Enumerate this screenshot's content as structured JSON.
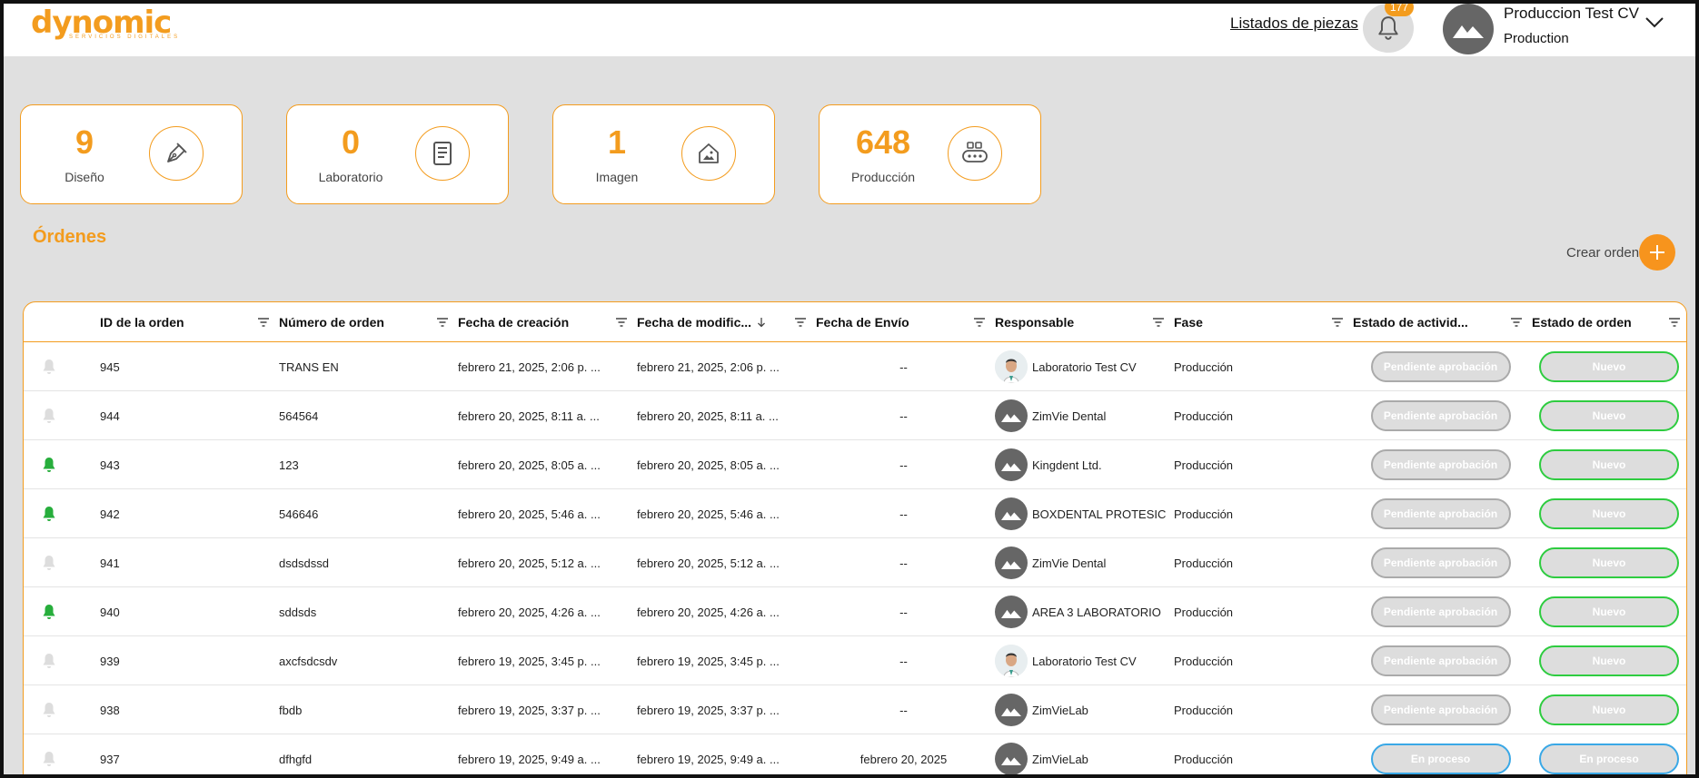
{
  "header": {
    "logo_text": "dynomic",
    "logo_sub": "SERVICIOS DIGITALES",
    "pieces_link": "Listados de piezas",
    "notifications_count": "177",
    "user_name": "Produccion Test CV",
    "user_role": "Production"
  },
  "cards": [
    {
      "value": "9",
      "label": "Diseño",
      "icon": "pen-nib-icon"
    },
    {
      "value": "0",
      "label": "Laboratorio",
      "icon": "document-icon"
    },
    {
      "value": "1",
      "label": "Imagen",
      "icon": "home-image-icon"
    },
    {
      "value": "648",
      "label": "Producción",
      "icon": "production-machine-icon"
    }
  ],
  "orders": {
    "title": "Órdenes",
    "create_label": "Crear orden"
  },
  "table": {
    "columns": [
      "ID de la orden",
      "Número de orden",
      "Fecha de creación",
      "Fecha de modific...",
      "Fecha de Envío",
      "Responsable",
      "Fase",
      "Estado de activid...",
      "Estado de orden"
    ],
    "rows": [
      {
        "alert": "off",
        "id": "945",
        "number": "TRANS EN",
        "created": "febrero 21, 2025, 2:06 p. ...",
        "modified": "febrero 21, 2025, 2:06 p. ...",
        "shipped": "--",
        "resp": "Laboratorio Test CV",
        "avatar": "photo",
        "phase": "Producción",
        "activity": "Pendiente aprobación",
        "activity_style": "gray",
        "status": "Nuevo",
        "status_style": "green"
      },
      {
        "alert": "off",
        "id": "944",
        "number": "564564",
        "created": "febrero 20, 2025, 8:11 a. ...",
        "modified": "febrero 20, 2025, 8:11 a. ...",
        "shipped": "--",
        "resp": "ZimVie Dental",
        "avatar": "generic",
        "phase": "Producción",
        "activity": "Pendiente aprobación",
        "activity_style": "gray",
        "status": "Nuevo",
        "status_style": "green"
      },
      {
        "alert": "on",
        "id": "943",
        "number": "123",
        "created": "febrero 20, 2025, 8:05 a. ...",
        "modified": "febrero 20, 2025, 8:05 a. ...",
        "shipped": "--",
        "resp": "Kingdent Ltd.",
        "avatar": "generic",
        "phase": "Producción",
        "activity": "Pendiente aprobación",
        "activity_style": "gray",
        "status": "Nuevo",
        "status_style": "green"
      },
      {
        "alert": "on",
        "id": "942",
        "number": "546646",
        "created": "febrero 20, 2025, 5:46 a. ...",
        "modified": "febrero 20, 2025, 5:46 a. ...",
        "shipped": "--",
        "resp": "BOXDENTAL PROTESIC",
        "avatar": "generic",
        "phase": "Producción",
        "activity": "Pendiente aprobación",
        "activity_style": "gray",
        "status": "Nuevo",
        "status_style": "green"
      },
      {
        "alert": "off",
        "id": "941",
        "number": "dsdsdssd",
        "created": "febrero 20, 2025, 5:12 a. ...",
        "modified": "febrero 20, 2025, 5:12 a. ...",
        "shipped": "--",
        "resp": "ZimVie Dental",
        "avatar": "generic",
        "phase": "Producción",
        "activity": "Pendiente aprobación",
        "activity_style": "gray",
        "status": "Nuevo",
        "status_style": "green"
      },
      {
        "alert": "on",
        "id": "940",
        "number": "sddsds",
        "created": "febrero 20, 2025, 4:26 a. ...",
        "modified": "febrero 20, 2025, 4:26 a. ...",
        "shipped": "--",
        "resp": "AREA 3 LABORATORIO",
        "avatar": "generic",
        "phase": "Producción",
        "activity": "Pendiente aprobación",
        "activity_style": "gray",
        "status": "Nuevo",
        "status_style": "green"
      },
      {
        "alert": "off",
        "id": "939",
        "number": "axcfsdcsdv",
        "created": "febrero 19, 2025, 3:45 p. ...",
        "modified": "febrero 19, 2025, 3:45 p. ...",
        "shipped": "--",
        "resp": "Laboratorio Test CV",
        "avatar": "photo",
        "phase": "Producción",
        "activity": "Pendiente aprobación",
        "activity_style": "gray",
        "status": "Nuevo",
        "status_style": "green"
      },
      {
        "alert": "off",
        "id": "938",
        "number": "fbdb",
        "created": "febrero 19, 2025, 3:37 p. ...",
        "modified": "febrero 19, 2025, 3:37 p. ...",
        "shipped": "--",
        "resp": "ZimVieLab",
        "avatar": "generic",
        "phase": "Producción",
        "activity": "Pendiente aprobación",
        "activity_style": "gray",
        "status": "Nuevo",
        "status_style": "green"
      },
      {
        "alert": "off",
        "id": "937",
        "number": "dfhgfd",
        "created": "febrero 19, 2025, 9:49 a. ...",
        "modified": "febrero 19, 2025, 9:49 a. ...",
        "shipped": "febrero 20, 2025",
        "resp": "ZimVieLab",
        "avatar": "generic",
        "phase": "Producción",
        "activity": "En proceso",
        "activity_style": "blue",
        "status": "En proceso",
        "status_style": "blue"
      }
    ]
  },
  "colors": {
    "accent": "#f39c1e",
    "alert_on": "#27ae3c",
    "alert_off": "#dddddd",
    "status_green": "#2ecc40",
    "status_blue": "#3aa8e6"
  }
}
